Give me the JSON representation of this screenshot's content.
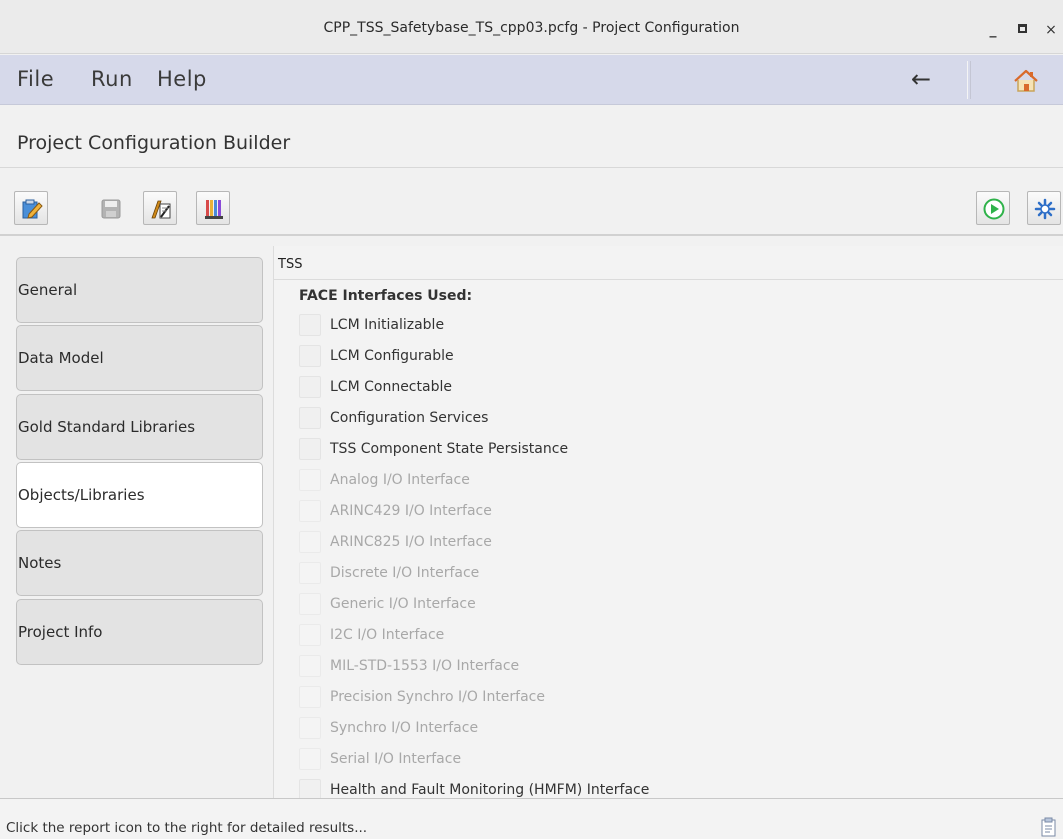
{
  "window": {
    "title": "CPP_TSS_Safetybase_TS_cpp03.pcfg - Project Configuration",
    "minimize_glyph": "_",
    "close_glyph": "×"
  },
  "menubar": {
    "items": [
      "File",
      "Run",
      "Help"
    ],
    "back_glyph": "←",
    "home_icon": "home-icon"
  },
  "header": {
    "title": "Project Configuration Builder"
  },
  "toolbar": {
    "left_icons": [
      "edit-icon",
      "save-icon",
      "report-write-icon",
      "library-icon"
    ],
    "right_icons": [
      "run-icon",
      "settings-icon"
    ]
  },
  "sidebar": {
    "tabs": [
      {
        "label": "General",
        "active": false
      },
      {
        "label": "Data Model",
        "active": false
      },
      {
        "label": "Gold Standard Libraries",
        "active": false
      },
      {
        "label": "Objects/Libraries",
        "active": true
      },
      {
        "label": "Notes",
        "active": false
      },
      {
        "label": "Project Info",
        "active": false
      }
    ]
  },
  "content": {
    "section": "TSS",
    "group_label": "FACE Interfaces Used:",
    "interfaces": [
      {
        "label": "LCM Initializable",
        "enabled": true
      },
      {
        "label": "LCM Configurable",
        "enabled": true
      },
      {
        "label": "LCM Connectable",
        "enabled": true
      },
      {
        "label": "Configuration Services",
        "enabled": true
      },
      {
        "label": "TSS Component State Persistance",
        "enabled": true
      },
      {
        "label": "Analog I/O Interface",
        "enabled": false
      },
      {
        "label": "ARINC429 I/O Interface",
        "enabled": false
      },
      {
        "label": "ARINC825 I/O Interface",
        "enabled": false
      },
      {
        "label": "Discrete I/O Interface",
        "enabled": false
      },
      {
        "label": "Generic I/O Interface",
        "enabled": false
      },
      {
        "label": "I2C I/O Interface",
        "enabled": false
      },
      {
        "label": "MIL-STD-1553 I/O Interface",
        "enabled": false
      },
      {
        "label": "Precision Synchro I/O Interface",
        "enabled": false
      },
      {
        "label": "Synchro I/O Interface",
        "enabled": false
      },
      {
        "label": "Serial I/O Interface",
        "enabled": false
      },
      {
        "label": "Health and Fault Monitoring (HMFM) Interface",
        "enabled": true
      }
    ]
  },
  "status": {
    "text": "Click the report icon to the right for detailed results..."
  },
  "colors": {
    "menubar_bg": "#d6d9ea",
    "run_green": "#2fb24a",
    "settings_blue": "#2e6fc8"
  }
}
